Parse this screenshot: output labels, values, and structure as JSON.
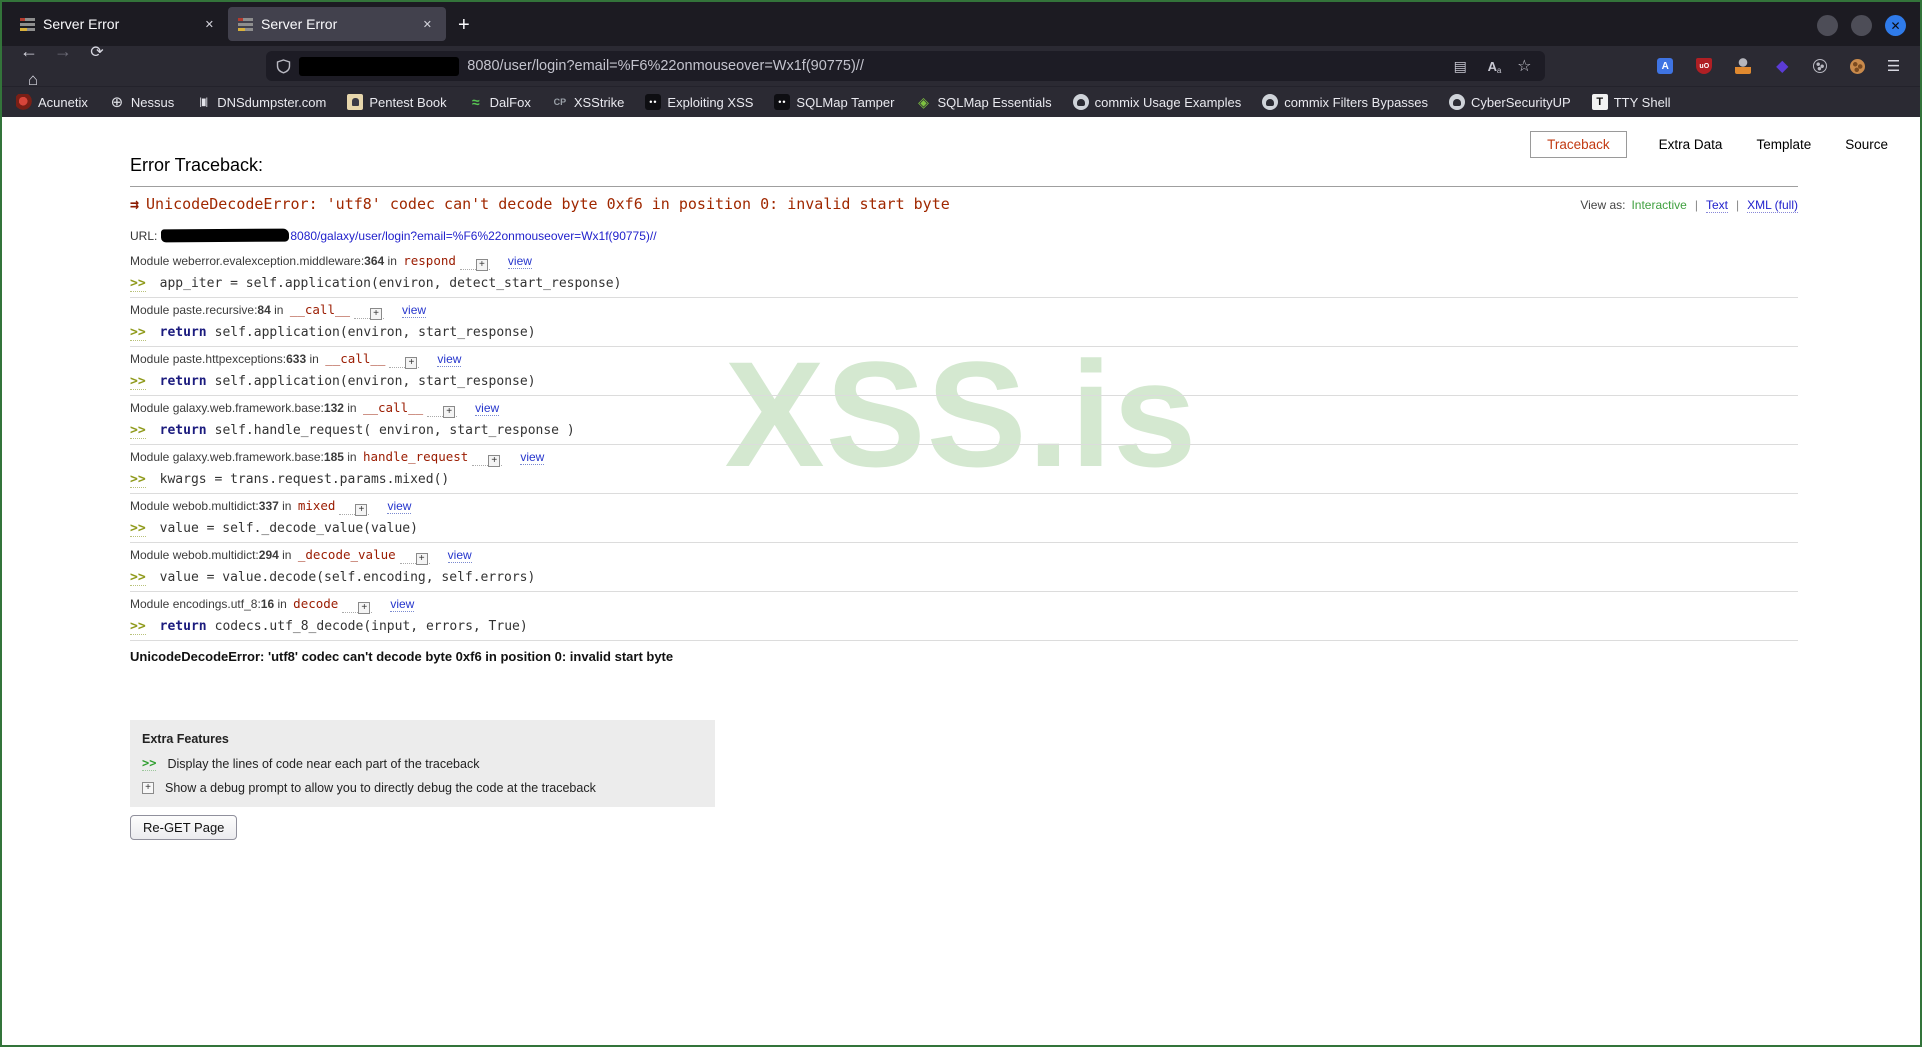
{
  "browser": {
    "tabs": [
      {
        "title": "Server Error"
      },
      {
        "title": "Server Error",
        "active": true
      }
    ],
    "new_tab_label": "+",
    "window_controls": [
      "minimize-icon",
      "maximize-icon",
      "close-icon"
    ],
    "nav_icons": [
      "back-icon",
      "forward-icon",
      "reload-icon",
      "home-icon"
    ],
    "urlbar": {
      "shield_icon": "shield-icon",
      "visible_url": "8080/user/login?email=%F6%22onmouseover=Wx1f(90775)//",
      "page_action_icons": [
        "reader-view-icon",
        "translate-page-icon",
        "bookmark-star-icon"
      ]
    },
    "extension_icons": [
      "translate-extension-icon",
      "ublock-origin-icon",
      "user-agent-switcher-icon",
      "foxyproxy-icon",
      "cookie-editor-icon",
      "cookie-quick-manager-icon"
    ],
    "bookmarks": [
      {
        "label": "Acunetix",
        "icon": "acunetix-icon"
      },
      {
        "label": "Nessus",
        "icon": "nessus-icon"
      },
      {
        "label": "DNSdumpster.com",
        "icon": "dnsdumpster-icon"
      },
      {
        "label": "Pentest Book",
        "icon": "pentest-book-icon"
      },
      {
        "label": "DalFox",
        "icon": "dalfox-icon"
      },
      {
        "label": "XSStrike",
        "icon": "xsstrike-icon"
      },
      {
        "label": "Exploiting XSS",
        "icon": "gitbook-icon"
      },
      {
        "label": "SQLMap Tamper",
        "icon": "gitbook-icon"
      },
      {
        "label": "SQLMap Essentials",
        "icon": "package-icon"
      },
      {
        "label": "commix Usage Examples",
        "icon": "github-icon"
      },
      {
        "label": "commix Filters Bypasses",
        "icon": "github-icon"
      },
      {
        "label": "CyberSecurityUP",
        "icon": "github-icon"
      },
      {
        "label": "TTY Shell",
        "icon": "tty-icon"
      }
    ]
  },
  "page": {
    "nav_buttons": [
      {
        "label": "Traceback",
        "active": true
      },
      {
        "label": "Extra Data"
      },
      {
        "label": "Template"
      },
      {
        "label": "Source"
      }
    ],
    "title": "Error Traceback:",
    "error_text": "UnicodeDecodeError: 'utf8' codec can't decode byte 0xf6 in position 0: invalid start byte",
    "view_as": {
      "label": "View as:",
      "options": [
        {
          "label": "Interactive",
          "color": "green"
        },
        {
          "label": "Text",
          "color": "blue"
        },
        {
          "label": "XML (full)",
          "color": "blue"
        }
      ]
    },
    "url_line": {
      "label": "URL:",
      "link": "8080/galaxy/user/login?email=%F6%22onmouseover=Wx1f(90775)//"
    },
    "labels": {
      "module": "Module",
      "in": "in",
      "view": "view",
      "prompt": ">>"
    },
    "frames": [
      {
        "module": "weberror.evalexception.middleware",
        "line": "364",
        "function": "respond",
        "keyword": "",
        "code": "app_iter = self.application(environ, detect_start_response)"
      },
      {
        "module": "paste.recursive",
        "line": "84",
        "function": "__call__",
        "keyword": "return",
        "code": "self.application(environ, start_response)"
      },
      {
        "module": "paste.httpexceptions",
        "line": "633",
        "function": "__call__",
        "keyword": "return",
        "code": "self.application(environ, start_response)"
      },
      {
        "module": "galaxy.web.framework.base",
        "line": "132",
        "function": "__call__",
        "keyword": "return",
        "code": "self.handle_request( environ, start_response )"
      },
      {
        "module": "galaxy.web.framework.base",
        "line": "185",
        "function": "handle_request",
        "keyword": "",
        "code": "kwargs = trans.request.params.mixed()"
      },
      {
        "module": "webob.multidict",
        "line": "337",
        "function": "mixed",
        "keyword": "",
        "code": "value = self._decode_value(value)"
      },
      {
        "module": "webob.multidict",
        "line": "294",
        "function": "_decode_value",
        "keyword": "",
        "code": "value = value.decode(self.encoding, self.errors)"
      },
      {
        "module": "encodings.utf_8",
        "line": "16",
        "function": "decode",
        "keyword": "return",
        "code": "codecs.utf_8_decode(input, errors, True)"
      }
    ],
    "final_error": "UnicodeDecodeError: 'utf8' codec can't decode byte 0xf6 in position 0: invalid start byte",
    "extra_features": {
      "title": "Extra Features",
      "items": [
        {
          "icon": "code-prompt-icon",
          "glyph": ">>",
          "text": "Display the lines of code near each part of the traceback"
        },
        {
          "icon": "expand-icon",
          "glyph": "+",
          "text": "Show a debug prompt to allow you to directly debug the code at the traceback"
        }
      ]
    },
    "reget_label": "Re-GET Page",
    "watermark": "XSS.is",
    "colors": {
      "error_red": "#a02800",
      "watermark_green": "#d4e8d0",
      "link_blue": "#2222cc",
      "interactive_green": "#3fa03f",
      "active_tab_bg": "#42414d"
    }
  }
}
